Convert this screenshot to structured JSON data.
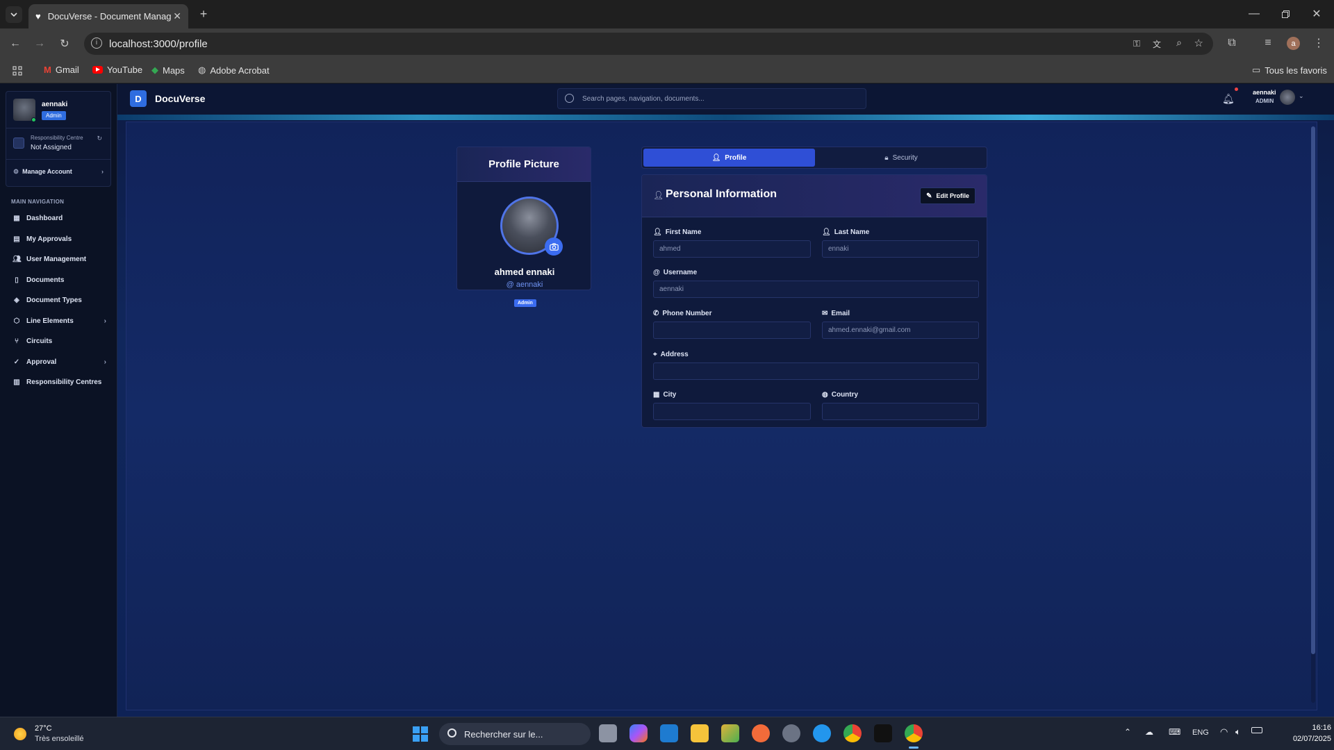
{
  "browser": {
    "tab_title": "DocuVerse - Document Manag",
    "url": "localhost:3000/profile",
    "bookmarks": [
      "Gmail",
      "YouTube",
      "Maps",
      "Adobe Acrobat"
    ],
    "all_favorites": "Tous les favoris",
    "profile_initial": "a"
  },
  "app": {
    "logo_letter": "D",
    "brand": "DocuVerse",
    "search_placeholder": "Search pages, navigation, documents...",
    "user": {
      "name": "aennaki",
      "role": "ADMIN"
    }
  },
  "sidebar": {
    "user_name": "aennaki",
    "user_badge": "Admin",
    "resp_centre_label": "Responsibility Centre",
    "resp_centre_value": "Not Assigned",
    "manage_account": "Manage Account",
    "section_title": "MAIN NAVIGATION",
    "items": [
      {
        "label": "Dashboard",
        "icon": "dashboard-icon"
      },
      {
        "label": "My Approvals",
        "icon": "clipboard-icon"
      },
      {
        "label": "User Management",
        "icon": "users-icon"
      },
      {
        "label": "Documents",
        "icon": "document-icon"
      },
      {
        "label": "Document Types",
        "icon": "layers-icon"
      },
      {
        "label": "Line Elements",
        "icon": "cube-icon",
        "has_children": true
      },
      {
        "label": "Circuits",
        "icon": "git-branch-icon"
      },
      {
        "label": "Approval",
        "icon": "user-check-icon",
        "has_children": true
      },
      {
        "label": "Responsibility Centres",
        "icon": "building-icon"
      }
    ]
  },
  "profile_card": {
    "title": "Profile Picture",
    "full_name": "ahmed ennaki",
    "username": "@ aennaki",
    "badge": "Admin"
  },
  "tabs": {
    "profile": "Profile",
    "security": "Security"
  },
  "personal_info": {
    "title": "Personal Information",
    "edit_button": "Edit Profile",
    "fields": {
      "first_name": {
        "label": "First Name",
        "value": "ahmed"
      },
      "last_name": {
        "label": "Last Name",
        "value": "ennaki"
      },
      "username": {
        "label": "Username",
        "value": "aennaki"
      },
      "phone": {
        "label": "Phone Number",
        "value": ""
      },
      "email": {
        "label": "Email",
        "value": "ahmed.ennaki@gmail.com"
      },
      "address": {
        "label": "Address",
        "value": ""
      },
      "city": {
        "label": "City",
        "value": ""
      },
      "country": {
        "label": "Country",
        "value": ""
      }
    }
  },
  "taskbar": {
    "weather_temp": "27°C",
    "weather_desc": "Très ensoleillé",
    "search_text": "Rechercher sur le...",
    "language": "ENG",
    "time": "16:16",
    "date": "02/07/2025"
  },
  "colors": {
    "accent": "#2f4fd6",
    "badge": "#3b6cf0",
    "background": "#0a1430"
  }
}
